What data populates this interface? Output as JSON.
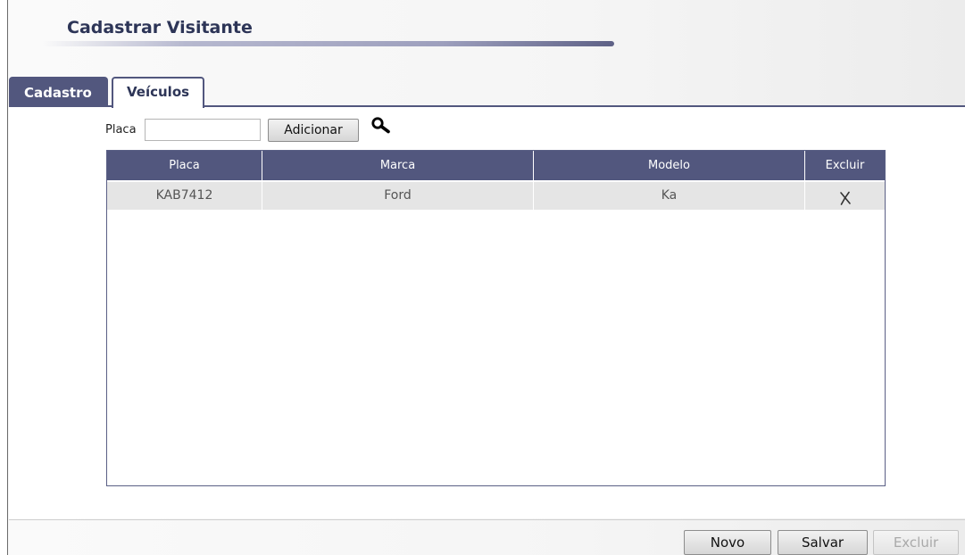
{
  "header": {
    "title": "Cadastrar Visitante"
  },
  "tabs": [
    {
      "label": "Cadastro",
      "active": false
    },
    {
      "label": "Veículos",
      "active": true
    }
  ],
  "form": {
    "placa_label": "Placa",
    "placa_value": "",
    "add_button": "Adicionar",
    "search_icon": "search-icon"
  },
  "table": {
    "columns": [
      "Placa",
      "Marca",
      "Modelo",
      "Excluir"
    ],
    "rows": [
      {
        "placa": "KAB7412",
        "marca": "Ford",
        "modelo": "Ka",
        "excluir_icon": "x-delete-icon"
      }
    ]
  },
  "footer": {
    "novo": "Novo",
    "salvar": "Salvar",
    "excluir": "Excluir"
  },
  "colors": {
    "accent": "#52577e",
    "title": "#2d3557",
    "row_bg": "#e5e5e5",
    "disabled_text": "#a9a9a9"
  }
}
